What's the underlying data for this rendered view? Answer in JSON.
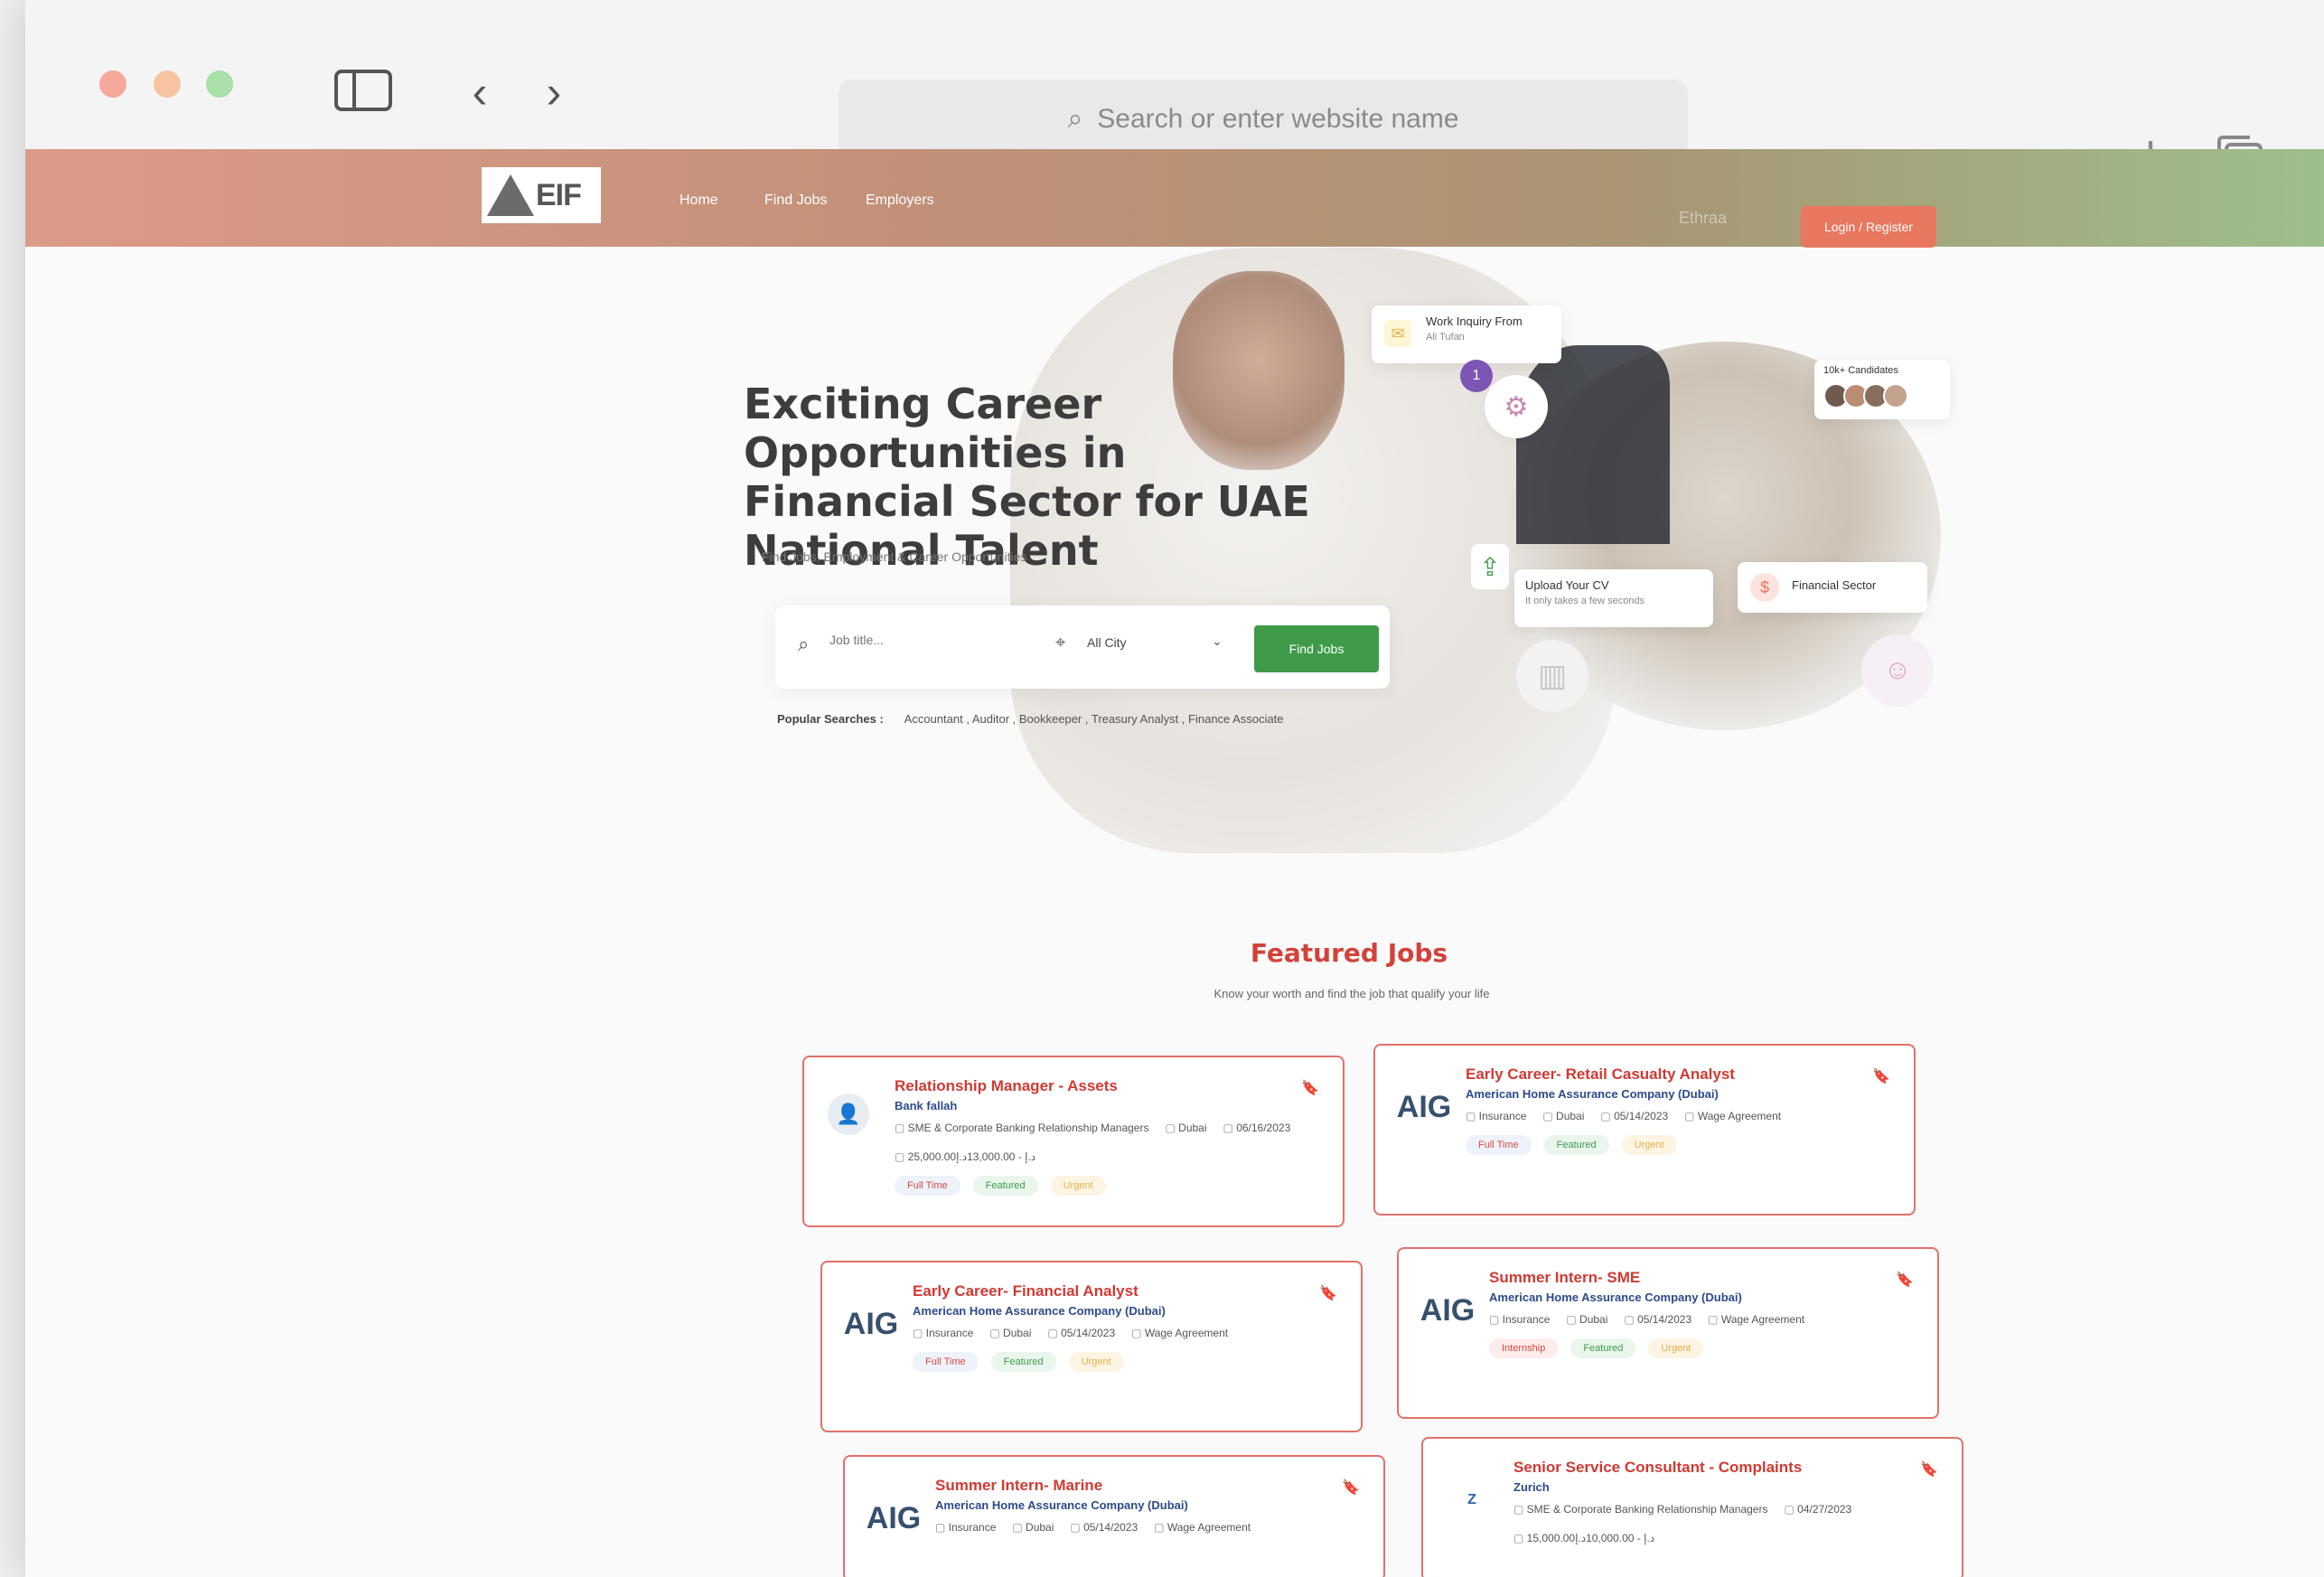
{
  "browser": {
    "address_placeholder": "Search or enter website name"
  },
  "nav": {
    "logo_text": "EIF",
    "links": [
      "Home",
      "Find Jobs",
      "Employers"
    ],
    "partner_logo": "Ethraa",
    "login_label": "Login / Register"
  },
  "hero": {
    "title_lines": [
      "Exciting Career Opportunities in",
      "Financial Sector for UAE",
      "National Talent"
    ],
    "subtitle": "Find Jobs, Employment & Career Opportunities",
    "search": {
      "job_placeholder": "Job title...",
      "city_value": "All City",
      "find_button": "Find Jobs"
    },
    "popular_label": "Popular Searches :",
    "popular_items": "Accountant , Auditor , Bookkeeper , Treasury Analyst , Finance Associate"
  },
  "collage": {
    "inquiry_title": "Work Inquiry From",
    "inquiry_name": "Ali Tufan",
    "candidates_label": "10k+ Candidates",
    "upload_title": "Upload Your CV",
    "upload_sub": "It only takes a few seconds",
    "sector_label": "Financial Sector",
    "badge_number": "1"
  },
  "featured": {
    "title": "Featured Jobs",
    "subtitle": "Know your worth and find the job that qualify your life",
    "jobs": [
      {
        "title": "Relationship Manager - Assets",
        "company": "Bank fallah",
        "category": "SME & Corporate Banking Relationship Managers",
        "location": "Dubai",
        "date": "06/16/2023",
        "salary": "25,000.00د.إ - 13,000.00د.إ",
        "tags": [
          "Full Time",
          "Featured",
          "Urgent"
        ]
      },
      {
        "title": "Early Career- Retail Casualty Analyst",
        "company": "American Home Assurance Company (Dubai)",
        "category": "Insurance",
        "location": "Dubai",
        "date": "05/14/2023",
        "salary": "Wage Agreement",
        "tags": [
          "Full Time",
          "Featured",
          "Urgent"
        ]
      },
      {
        "title": "Early Career- Financial Analyst",
        "company": "American Home Assurance Company (Dubai)",
        "category": "Insurance",
        "location": "Dubai",
        "date": "05/14/2023",
        "salary": "Wage Agreement",
        "tags": [
          "Full Time",
          "Featured",
          "Urgent"
        ]
      },
      {
        "title": "Summer Intern- SME",
        "company": "American Home Assurance Company (Dubai)",
        "category": "Insurance",
        "location": "Dubai",
        "date": "05/14/2023",
        "salary": "Wage Agreement",
        "tags": [
          "Internship",
          "Featured",
          "Urgent"
        ]
      },
      {
        "title": "Summer Intern- Marine",
        "company": "American Home Assurance Company (Dubai)",
        "category": "Insurance",
        "location": "Dubai",
        "date": "05/14/2023",
        "salary": "Wage Agreement",
        "tags": []
      },
      {
        "title": "Senior Service Consultant - Complaints",
        "company": "Zurich",
        "category": "SME & Corporate Banking Relationship Managers",
        "location": "",
        "date": "04/27/2023",
        "salary": "15,000.00د.إ - 10,000.00د.إ",
        "tags": []
      }
    ]
  },
  "colors": {
    "accent_red": "#d2423a",
    "accent_green": "#3f9b4a",
    "login_orange": "#e8775f"
  }
}
